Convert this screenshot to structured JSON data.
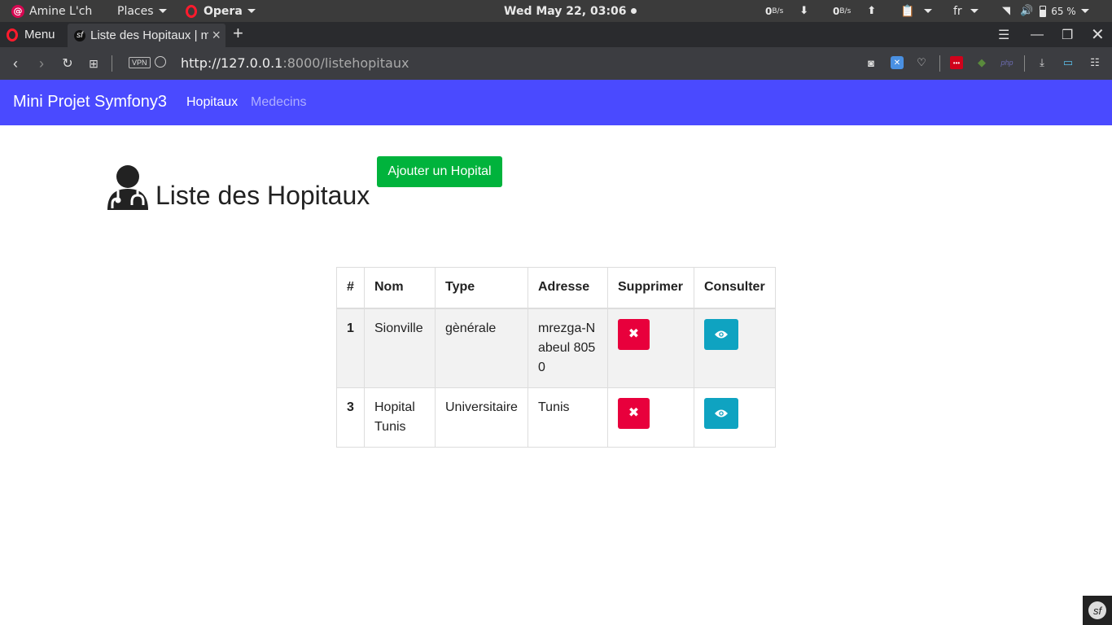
{
  "system": {
    "user": "Amine L'ch",
    "places": "Places",
    "app": "Opera",
    "clock": "Wed May 22, 03:06",
    "net_down": "0",
    "net_down_unit": "B/s",
    "net_up": "0",
    "net_up_unit": "B/s",
    "lang": "fr",
    "battery": "65 %"
  },
  "browser": {
    "menu_label": "Menu",
    "tab_title": "Liste des Hopitaux | m",
    "url_host": "http://127.0.0.1",
    "url_rest": ":8000/listehopitaux",
    "vpn": "VPN"
  },
  "navbar": {
    "brand": "Mini Projet Symfony3",
    "links": [
      "Hopitaux",
      "Medecins"
    ]
  },
  "page": {
    "title": "Liste des Hopitaux",
    "add_button": "Ajouter un Hopital"
  },
  "table": {
    "headers": [
      "#",
      "Nom",
      "Type",
      "Adresse",
      "Supprimer",
      "Consulter"
    ],
    "rows": [
      {
        "id": "1",
        "nom": "Sionville",
        "type": "gènérale",
        "adresse": "mrezga-Nabeul 8050"
      },
      {
        "id": "3",
        "nom": "Hopital Tunis",
        "type": "Universitaire",
        "adresse": "Tunis"
      }
    ]
  },
  "colors": {
    "navbar": "#4a4aff",
    "add_button": "#00b33c",
    "delete_button": "#e8003c",
    "view_button": "#0fa3c1"
  },
  "icons": {
    "delete": "times-icon",
    "view": "eye-icon",
    "heading": "user-doctor-icon"
  }
}
